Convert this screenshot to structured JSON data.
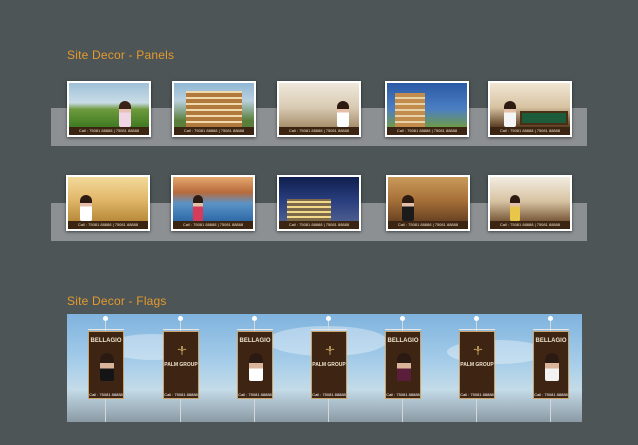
{
  "sections": {
    "panels_title": "Site Decor - Panels",
    "flags_title": "Site Decor - Flags"
  },
  "panels_row1": [
    {
      "caption": "",
      "strip": "Call : 75081 88888 | 75081 88888",
      "scene": "woman-garden"
    },
    {
      "caption": "",
      "strip": "Call : 75081 88888 | 75081 88888",
      "scene": "apartments"
    },
    {
      "caption": "",
      "strip": "Call : 75081 88888 | 75081 88888",
      "scene": "living-room"
    },
    {
      "caption": "",
      "strip": "Call : 75081 88888 | 75081 88888",
      "scene": "building-blue"
    },
    {
      "caption": "",
      "strip": "Call : 75081 88888 | 75081 88888",
      "scene": "billiards"
    }
  ],
  "panels_row2": [
    {
      "caption": "",
      "strip": "Call : 75081 88888 | 75081 88888",
      "scene": "woman-sunset"
    },
    {
      "caption": "",
      "strip": "Call : 75081 88888 | 75081 88888",
      "scene": "pool"
    },
    {
      "caption": "",
      "strip": "Call : 75081 88888 | 75081 88888",
      "scene": "night-towers"
    },
    {
      "caption": "",
      "strip": "Call : 75081 88888 | 75081 88888",
      "scene": "woman-interior"
    },
    {
      "caption": "",
      "strip": "Call : 75081 88888 | 75081 88888",
      "scene": "lounge"
    }
  ],
  "flags": [
    {
      "type": "bellagio",
      "logo_a": "",
      "logo_b": "BELLAGIO",
      "tag": "",
      "call": "Call : 75081 88888"
    },
    {
      "type": "palm",
      "logo_a": "",
      "logo_b": "PALM GROUP",
      "tag": "",
      "call": "Call : 75081 88888"
    },
    {
      "type": "bellagio",
      "logo_a": "",
      "logo_b": "BELLAGIO",
      "tag": "",
      "call": "Call : 75081 88888"
    },
    {
      "type": "palm",
      "logo_a": "",
      "logo_b": "PALM GROUP",
      "tag": "",
      "call": "Call : 75081 88888"
    },
    {
      "type": "bellagio",
      "logo_a": "",
      "logo_b": "BELLAGIO",
      "tag": "",
      "call": "Call : 75081 88888"
    },
    {
      "type": "palm",
      "logo_a": "",
      "logo_b": "PALM GROUP",
      "tag": "",
      "call": "Call : 75081 88888"
    },
    {
      "type": "bellagio",
      "logo_a": "",
      "logo_b": "BELLAGIO",
      "tag": "",
      "call": "Call : 75081 88888"
    }
  ],
  "colors": {
    "background": "#4d5557",
    "title": "#e59a2c",
    "band": "#8c9092",
    "flag_brown": "#3e2413"
  }
}
